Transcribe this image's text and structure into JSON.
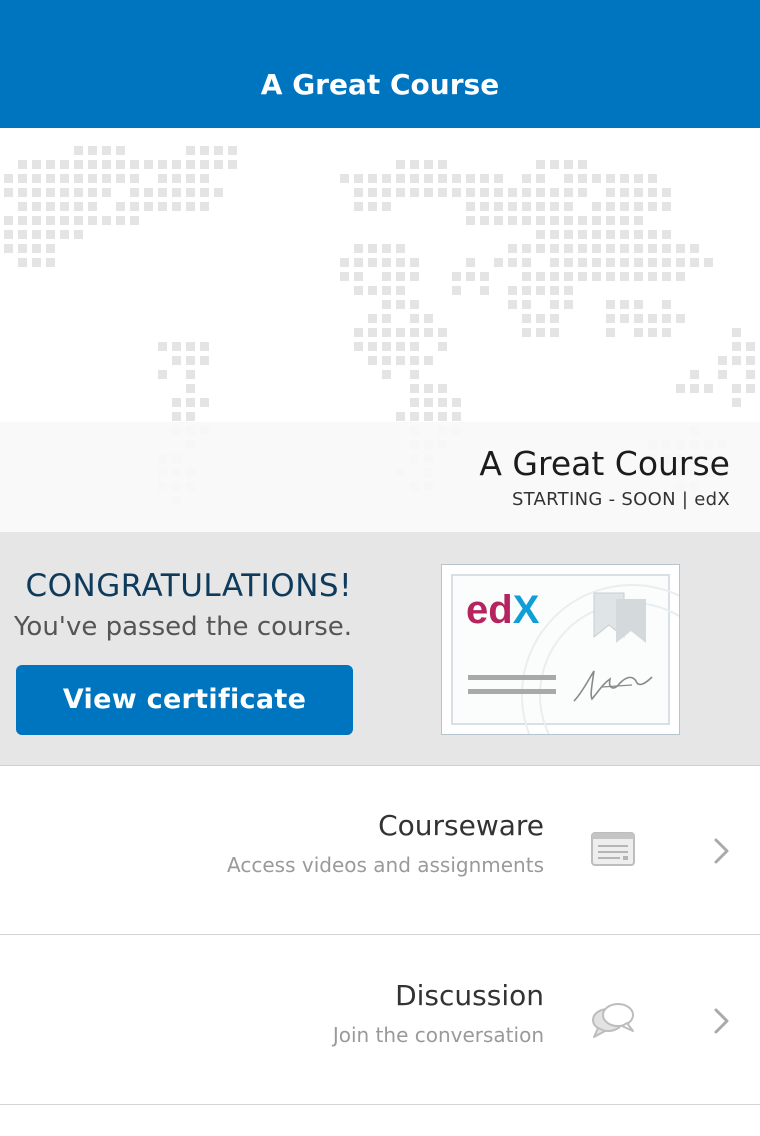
{
  "navbar": {
    "title": "A Great Course"
  },
  "course_header": {
    "title": "A Great Course",
    "subtitle": "STARTING - SOON | edX"
  },
  "certificate_banner": {
    "heading": "CONGRATULATIONS!",
    "message": "You've passed the course.",
    "button_label": "View certificate",
    "thumbnail_logo": "edX"
  },
  "menu": [
    {
      "title": "Courseware",
      "subtitle": "Access videos and assignments",
      "icon": "courseware-icon"
    },
    {
      "title": "Discussion",
      "subtitle": "Join the conversation",
      "icon": "discussion-icon"
    }
  ],
  "colors": {
    "primary": "#0075bf",
    "heading": "#0e3a5c",
    "banner_bg": "#e6e6e6",
    "edx_magenta": "#b5245e",
    "edx_blue": "#0f9fd6"
  }
}
